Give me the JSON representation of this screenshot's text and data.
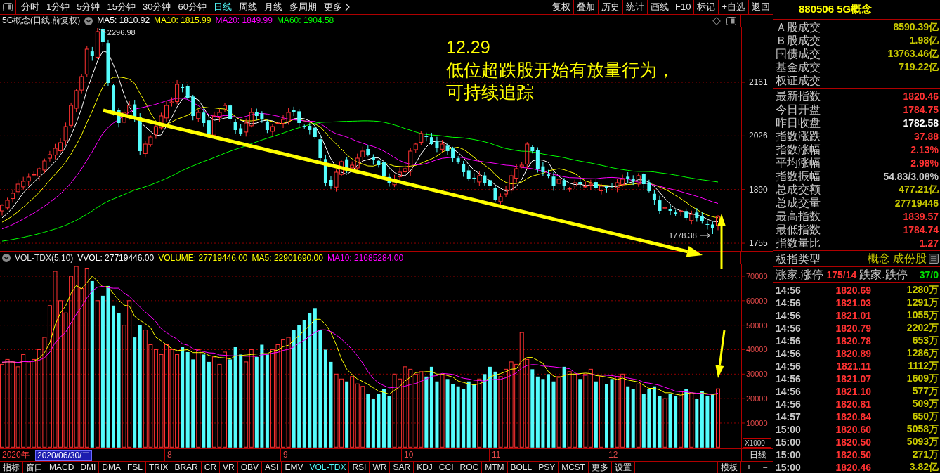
{
  "toolbar": {
    "periods": [
      {
        "label": "分时",
        "selected": false
      },
      {
        "label": "1分钟",
        "selected": false
      },
      {
        "label": "5分钟",
        "selected": false
      },
      {
        "label": "15分钟",
        "selected": false
      },
      {
        "label": "30分钟",
        "selected": false
      },
      {
        "label": "60分钟",
        "selected": false
      },
      {
        "label": "日线",
        "selected": true
      },
      {
        "label": "周线",
        "selected": false
      },
      {
        "label": "月线",
        "selected": false
      },
      {
        "label": "多周期",
        "selected": false
      }
    ],
    "more": "更多",
    "actions": [
      "复权",
      "叠加",
      "历史",
      "统计",
      "画线",
      "F10",
      "标记",
      "+自选",
      "返回"
    ]
  },
  "price_chart": {
    "title": "5G概念(日线.前复权)",
    "indicators": [
      {
        "label": "MA5: 1810.92",
        "color": "#ffffff"
      },
      {
        "label": "MA10: 1815.99",
        "color": "#ffff00"
      },
      {
        "label": "MA20: 1849.99",
        "color": "#ff00ff"
      },
      {
        "label": "MA60: 1904.58",
        "color": "#00ff00"
      }
    ],
    "y_labels": [
      "2161",
      "2026",
      "1890",
      "1755"
    ],
    "high_label": "2296.98",
    "low_label": "1778.38"
  },
  "annotation": {
    "date": "12.29",
    "note": "低位超跌股开始有放量行为，可持续追踪"
  },
  "volume_chart": {
    "title": "VOL-TDX(5,10)",
    "indicators": [
      {
        "label": "VVOL: 27719446.00",
        "color": "#ffffff"
      },
      {
        "label": "VOLUME: 27719446.00",
        "color": "#ffff00"
      },
      {
        "label": "MA5: 22901690.00",
        "color": "#ffff00"
      },
      {
        "label": "MA10: 21685284.00",
        "color": "#ff00ff"
      }
    ],
    "y_labels": [
      "70000",
      "60000",
      "50000",
      "40000",
      "30000",
      "20000",
      "10000"
    ],
    "unit": "X1000"
  },
  "date_axis": {
    "year": "2020年",
    "cursor_date": "2020/06/30/二",
    "months": [
      "8",
      "9",
      "10",
      "11",
      "12"
    ],
    "period": "日线"
  },
  "indicator_bar": {
    "menus": [
      "指标",
      "窗口"
    ],
    "tabs": [
      {
        "label": "MACD",
        "selected": false
      },
      {
        "label": "DMI",
        "selected": false
      },
      {
        "label": "DMA",
        "selected": false
      },
      {
        "label": "FSL",
        "selected": false
      },
      {
        "label": "TRIX",
        "selected": false
      },
      {
        "label": "BRAR",
        "selected": false
      },
      {
        "label": "CR",
        "selected": false
      },
      {
        "label": "VR",
        "selected": false
      },
      {
        "label": "OBV",
        "selected": false
      },
      {
        "label": "ASI",
        "selected": false
      },
      {
        "label": "EMV",
        "selected": false
      },
      {
        "label": "VOL-TDX",
        "selected": true
      },
      {
        "label": "RSI",
        "selected": false
      },
      {
        "label": "WR",
        "selected": false
      },
      {
        "label": "SAR",
        "selected": false
      },
      {
        "label": "KDJ",
        "selected": false
      },
      {
        "label": "CCI",
        "selected": false
      },
      {
        "label": "ROC",
        "selected": false
      },
      {
        "label": "MTM",
        "selected": false
      },
      {
        "label": "BOLL",
        "selected": false
      },
      {
        "label": "PSY",
        "selected": false
      },
      {
        "label": "MCST",
        "selected": false
      }
    ],
    "more": "更多",
    "settings": "设置",
    "template": "模板",
    "zoom_in": "+",
    "zoom_out": "−"
  },
  "quote_panel": {
    "title": "880506 5G概念",
    "market": [
      {
        "label": "Ａ股成交",
        "value": "8590.39亿"
      },
      {
        "label": "Ｂ股成交",
        "value": "1.98亿"
      },
      {
        "label": "国债成交",
        "value": "13763.46亿"
      },
      {
        "label": "基金成交",
        "value": "719.22亿"
      },
      {
        "label": "权证成交"
      }
    ],
    "stats": [
      {
        "label": "最新指数",
        "value": "1820.46",
        "color": "#ff3232"
      },
      {
        "label": "今日开盘",
        "value": "1784.75",
        "color": "#ff3232"
      },
      {
        "label": "昨日收盘",
        "value": "1782.58",
        "color": "#ffffff"
      },
      {
        "label": "指数涨跌",
        "value": "37.88",
        "color": "#ff3232"
      },
      {
        "label": "指数涨幅",
        "value": "2.13%",
        "color": "#ff3232"
      },
      {
        "label": "平均涨幅",
        "value": "2.98%",
        "color": "#ff3232"
      },
      {
        "label": "指数振幅",
        "value": "54.83/3.08%",
        "color": "#c8c8c8"
      },
      {
        "label": "总成交额",
        "value": "477.21亿",
        "color": "#c8c800"
      },
      {
        "label": "总成交量",
        "value": "27719446",
        "color": "#c8c800"
      },
      {
        "label": "最高指数",
        "value": "1839.57",
        "color": "#ff3232"
      },
      {
        "label": "最低指数",
        "value": "1784.74",
        "color": "#ff3232"
      },
      {
        "label": "指数量比",
        "value": "1.27",
        "color": "#ff3232"
      }
    ],
    "board": {
      "label": "板指类型",
      "value": "概念 成份股"
    },
    "breadth": {
      "up_label": "涨家.涨停",
      "up_value": "175/14",
      "down_label": "跌家.跌停",
      "down_value": "37/0"
    },
    "ticks": [
      {
        "time": "14:56",
        "price": "1820.69",
        "volume": "1280万"
      },
      {
        "time": "14:56",
        "price": "1821.03",
        "volume": "1291万"
      },
      {
        "time": "14:56",
        "price": "1821.01",
        "volume": "1055万"
      },
      {
        "time": "14:56",
        "price": "1820.79",
        "volume": "2202万"
      },
      {
        "time": "14:56",
        "price": "1820.78",
        "volume": "653万"
      },
      {
        "time": "14:56",
        "price": "1820.89",
        "volume": "1286万"
      },
      {
        "time": "14:56",
        "price": "1821.11",
        "volume": "1112万"
      },
      {
        "time": "14:56",
        "price": "1821.07",
        "volume": "1609万"
      },
      {
        "time": "14:56",
        "price": "1821.10",
        "volume": "577万"
      },
      {
        "time": "14:56",
        "price": "1820.81",
        "volume": "509万"
      },
      {
        "time": "14:57",
        "price": "1820.84",
        "volume": "650万"
      },
      {
        "time": "15:00",
        "price": "1820.60",
        "volume": "5058万"
      },
      {
        "time": "15:00",
        "price": "1820.50",
        "volume": "5093万"
      },
      {
        "time": "15:00",
        "price": "1820.50",
        "volume": "271万"
      },
      {
        "time": "15:00",
        "price": "1820.46",
        "volume": "3.82亿"
      }
    ]
  }
}
